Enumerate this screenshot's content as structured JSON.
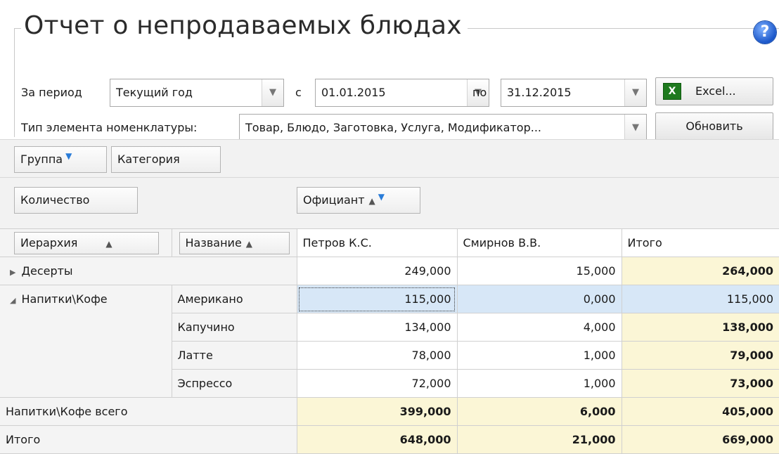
{
  "window": {
    "title": "Отчет о непродаваемых блюдах",
    "help_label": "?"
  },
  "filters": {
    "period_label": "За период",
    "period_value": "Текущий год",
    "from_label": "с",
    "from_value": "01.01.2015",
    "to_label": "по",
    "to_value": "31.12.2015",
    "excel_label": "Excel...",
    "type_label": "Тип элемента номенклатуры:",
    "type_value": "Товар, Блюдо, Заготовка, Услуга, Модификатор...",
    "refresh_label": "Обновить"
  },
  "pivot": {
    "filter_fields": [
      "Группа",
      "Категория"
    ],
    "data_field": "Количество",
    "column_field": "Официант",
    "row_fields": [
      "Иерархия",
      "Название"
    ]
  },
  "table": {
    "columns": [
      "Петров К.С.",
      "Смирнов В.В.",
      "Итого"
    ],
    "rows": [
      {
        "group": "Десерты",
        "name": "",
        "expanded": false,
        "values": [
          "249,000",
          "15,000",
          "264,000"
        ]
      },
      {
        "group": "Напитки\\Кофе",
        "name": "Американо",
        "expanded": true,
        "values": [
          "115,000",
          "0,000",
          "115,000"
        ]
      },
      {
        "group": "",
        "name": "Капучино",
        "values": [
          "134,000",
          "4,000",
          "138,000"
        ]
      },
      {
        "group": "",
        "name": "Латте",
        "values": [
          "78,000",
          "1,000",
          "79,000"
        ]
      },
      {
        "group": "",
        "name": "Эспрессо",
        "values": [
          "72,000",
          "1,000",
          "73,000"
        ]
      }
    ],
    "subtotal": {
      "label": "Напитки\\Кофе всего",
      "values": [
        "399,000",
        "6,000",
        "405,000"
      ]
    },
    "total": {
      "label": "Итого",
      "values": [
        "648,000",
        "21,000",
        "669,000"
      ]
    }
  },
  "colors": {
    "total_bg": "#fbf6d6",
    "selected_bg": "#d7e7f7",
    "filter_icon": "#2a7cd8"
  }
}
